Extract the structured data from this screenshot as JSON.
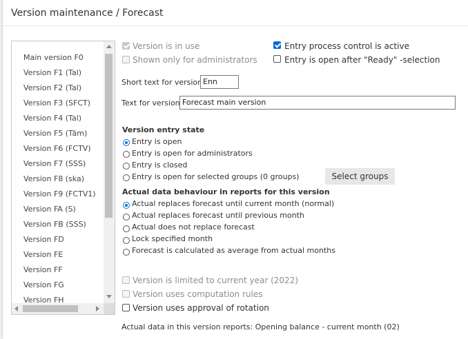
{
  "dialog": {
    "title": "Version maintenance / Forecast"
  },
  "version_list": {
    "items": [
      "Main version F0",
      "Version F1 (Tal)",
      "Version F2 (Tal)",
      "Version F3 (SFCT)",
      "Version F4 (Tal)",
      "Version F5 (Täm)",
      "Version F6 (FCTV)",
      "Version F7 (SSS)",
      "Version F8 (ska)",
      "Version F9 (FCTV1)",
      "Version FA (S)",
      "Version FB (SSS)",
      "Version FD",
      "Version FE",
      "Version FF",
      "Version FG",
      "Version FH"
    ]
  },
  "flags": {
    "in_use": {
      "label": "Version is in use",
      "checked": true,
      "disabled": true
    },
    "admins_only": {
      "label": "Shown only for administrators",
      "checked": false,
      "disabled": true
    },
    "process_control": {
      "label": "Entry process control is active",
      "checked": true
    },
    "open_after_ready": {
      "label": "Entry is open after \"Ready\" -selection",
      "checked": false
    }
  },
  "short_text": {
    "label": "Short text for version:",
    "value": "Enn"
  },
  "text": {
    "label": "Text for version:",
    "value": "Forecast main version"
  },
  "entry_state": {
    "title": "Version entry state",
    "options": [
      "Entry is open",
      "Entry is open for administrators",
      "Entry is closed",
      "Entry is open for selected groups (0 groups)"
    ],
    "selected": 0,
    "select_groups_label": "Select groups"
  },
  "actual_behaviour": {
    "title": "Actual data behaviour in reports for this version",
    "options": [
      "Actual replaces forecast until current month (normal)",
      "Actual replaces forecast until previous month",
      "Actual does not replace forecast",
      "Lock specified month",
      "Forecast is calculated as average from actual months"
    ],
    "selected": 0
  },
  "bottom_flags": {
    "limited_year": {
      "label": "Version is limited to current year (2022)",
      "checked": false,
      "disabled": true
    },
    "computation_rules": {
      "label": "Version uses computation rules",
      "checked": false,
      "disabled": true
    },
    "approval_rotation": {
      "label": "Version uses approval of rotation",
      "checked": false
    }
  },
  "footer_note": "Actual data in this version reports: Opening balance - current month (02)"
}
